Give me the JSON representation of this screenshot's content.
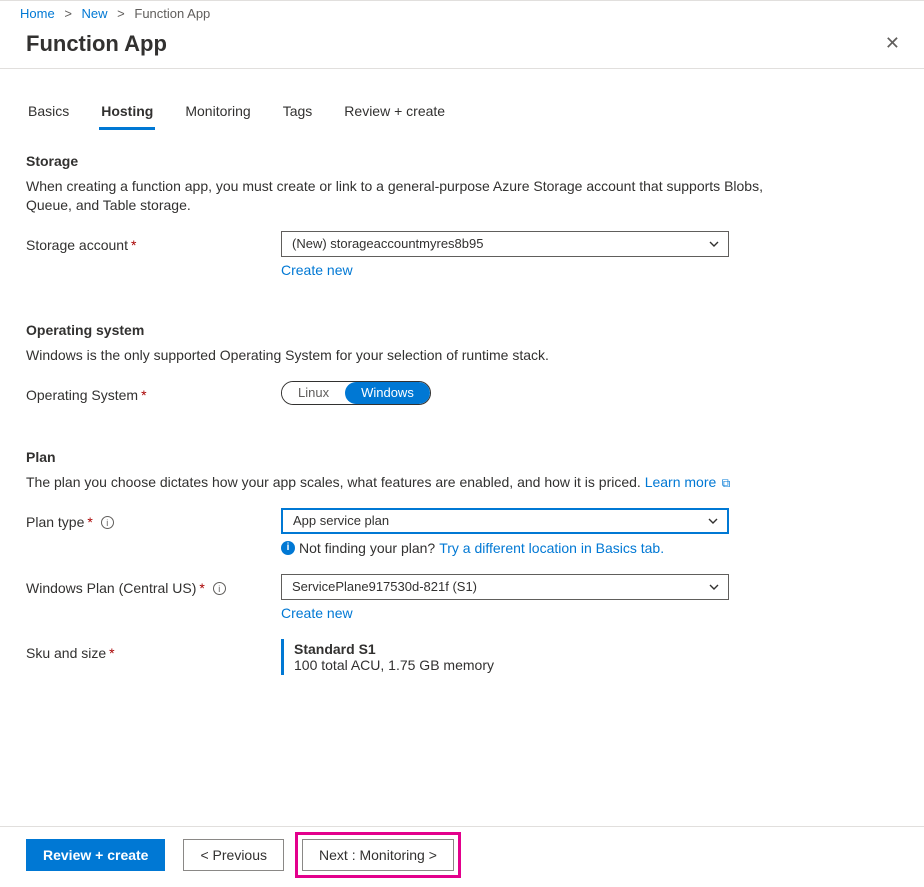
{
  "breadcrumb": {
    "home": "Home",
    "new": "New",
    "current": "Function App"
  },
  "title": "Function App",
  "tabs": [
    "Basics",
    "Hosting",
    "Monitoring",
    "Tags",
    "Review + create"
  ],
  "activeTab": "Hosting",
  "storage": {
    "heading": "Storage",
    "description": "When creating a function app, you must create or link to a general-purpose Azure Storage account that supports Blobs, Queue, and Table storage.",
    "accountLabel": "Storage account",
    "accountValue": "(New) storageaccountmyres8b95",
    "createNew": "Create new"
  },
  "os": {
    "heading": "Operating system",
    "description": "Windows is the only supported Operating System for your selection of runtime stack.",
    "label": "Operating System",
    "options": [
      "Linux",
      "Windows"
    ],
    "selected": "Windows"
  },
  "plan": {
    "heading": "Plan",
    "description": "The plan you choose dictates how your app scales, what features are enabled, and how it is priced.",
    "learnMore": "Learn more",
    "typeLabel": "Plan type",
    "typeValue": "App service plan",
    "notFindingText": "Not finding your plan?",
    "notFindingLink": "Try a different location in Basics tab.",
    "winPlanLabel": "Windows Plan (Central US)",
    "winPlanValue": "ServicePlane917530d-821f (S1)",
    "createNew": "Create new",
    "skuLabel": "Sku and size",
    "skuName": "Standard S1",
    "skuDetail": "100 total ACU, 1.75 GB memory"
  },
  "footer": {
    "review": "Review + create",
    "previous": "< Previous",
    "next": "Next : Monitoring >"
  }
}
